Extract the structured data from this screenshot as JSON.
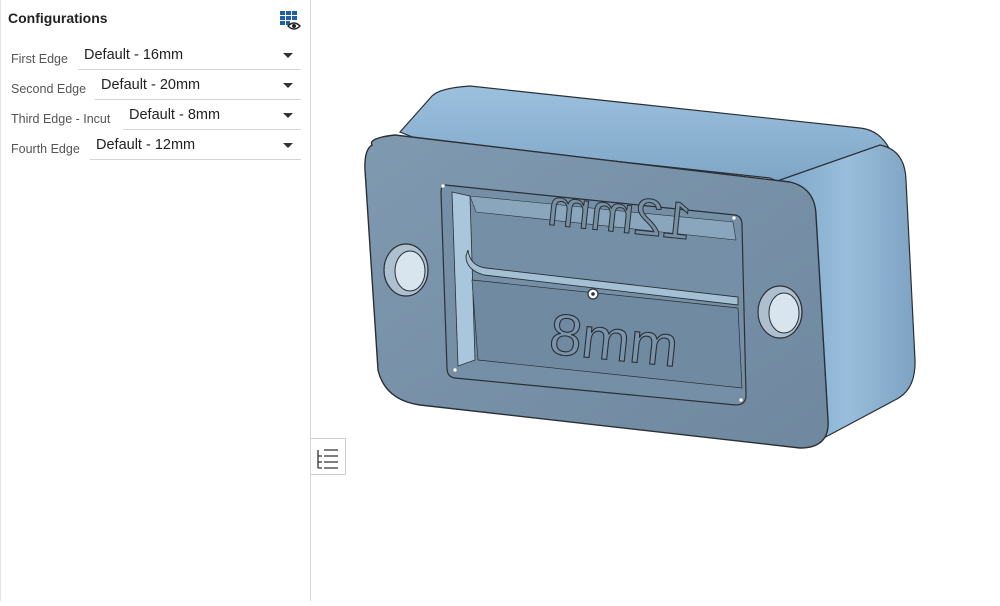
{
  "panel": {
    "title": "Configurations",
    "icon": "table-eye-icon"
  },
  "configs": [
    {
      "label": "First Edge",
      "value": "Default - 16mm"
    },
    {
      "label": "Second Edge",
      "value": "Default - 20mm"
    },
    {
      "label": "Third Edge - Incut",
      "value": "Default - 8mm"
    },
    {
      "label": "Fourth Edge",
      "value": "Default - 12mm"
    }
  ],
  "side_toggle": {
    "icon": "list-tree-icon"
  },
  "model": {
    "engraving_top": "12mm",
    "engraving_bottom": "8mm",
    "colors": {
      "face": "#7d97ae",
      "side": "#8fb4d3",
      "top": "#86a9c8",
      "edge": "#2a2f35"
    }
  }
}
